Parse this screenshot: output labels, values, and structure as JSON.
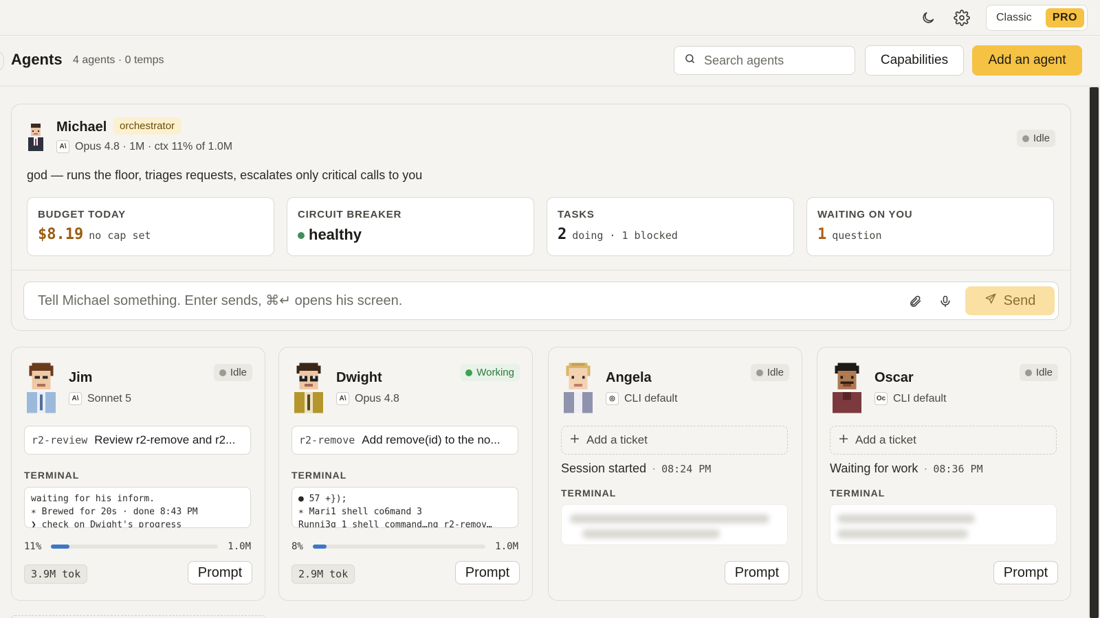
{
  "topbar": {
    "mode_classic": "Classic",
    "mode_pro": "PRO",
    "icons": [
      "moon-icon",
      "gear-icon"
    ]
  },
  "header": {
    "title": "Agents",
    "subtitle": "4 agents · 0 temps",
    "search_placeholder": "Search agents",
    "capabilities_label": "Capabilities",
    "add_agent_label": "Add an agent"
  },
  "orchestrator": {
    "name": "Michael",
    "role": "orchestrator",
    "model": "Opus 4.8 · 1M · ctx 11% of 1.0M",
    "model_icon": "A\\",
    "status": "Idle",
    "description": "god — runs the floor, triages requests, escalates only critical calls to you",
    "metrics": [
      {
        "label": "BUDGET TODAY",
        "value": "$8.19",
        "detail": "no cap set",
        "color": "#9a5d0f"
      },
      {
        "label": "CIRCUIT BREAKER",
        "value": "healthy",
        "detail": "",
        "color": "#1c1b18"
      },
      {
        "label": "TASKS",
        "value": "2",
        "detail": "doing · 1 blocked",
        "color": "#1c1b18"
      },
      {
        "label": "WAITING ON YOU",
        "value": "1",
        "detail": "question",
        "color": "#b25d14"
      }
    ],
    "composer_placeholder": "Tell Michael something. Enter sends, ⌘↵ opens his screen.",
    "send_label": "Send"
  },
  "agents": [
    {
      "name": "Jim",
      "model_icon": "A\\",
      "model": "Sonnet 5",
      "status": "Idle",
      "ticket_id": "r2-review",
      "ticket_title": "Review r2-remove and r2...",
      "terminal_label": "TERMINAL",
      "terminal_lines": [
        "waiting for his inform.",
        "∗ Brewed for 20s · done 8:43 PM",
        "❯ check on Dwight's progress"
      ],
      "ctx_pct_label": "11%",
      "ctx_fraction": 0.11,
      "ctx_max": "1.0M",
      "tokens": "3.9M tok",
      "prompt_label": "Prompt"
    },
    {
      "name": "Dwight",
      "model_icon": "A\\",
      "model": "Opus 4.8",
      "status": "Working",
      "ticket_id": "r2-remove",
      "ticket_title": "Add remove(id) to the no...",
      "terminal_label": "TERMINAL",
      "terminal_lines": [
        "● 57 +});",
        "∗ Mari1 shell co6mand 3",
        "Runni3g 1 shell command…ng r2-remov…"
      ],
      "ctx_pct_label": "8%",
      "ctx_fraction": 0.08,
      "ctx_max": "1.0M",
      "tokens": "2.9M tok",
      "prompt_label": "Prompt"
    },
    {
      "name": "Angela",
      "model_icon": "◎",
      "model": "CLI default",
      "status": "Idle",
      "add_ticket_label": "Add a ticket",
      "session_text": "Session started",
      "session_time": "08:24 PM",
      "terminal_label": "TERMINAL",
      "prompt_label": "Prompt"
    },
    {
      "name": "Oscar",
      "model_icon": "Oc",
      "model": "CLI default",
      "status": "Idle",
      "add_ticket_label": "Add a ticket",
      "session_text": "Waiting for work",
      "session_time": "08:36 PM",
      "terminal_label": "TERMINAL",
      "prompt_label": "Prompt"
    }
  ]
}
